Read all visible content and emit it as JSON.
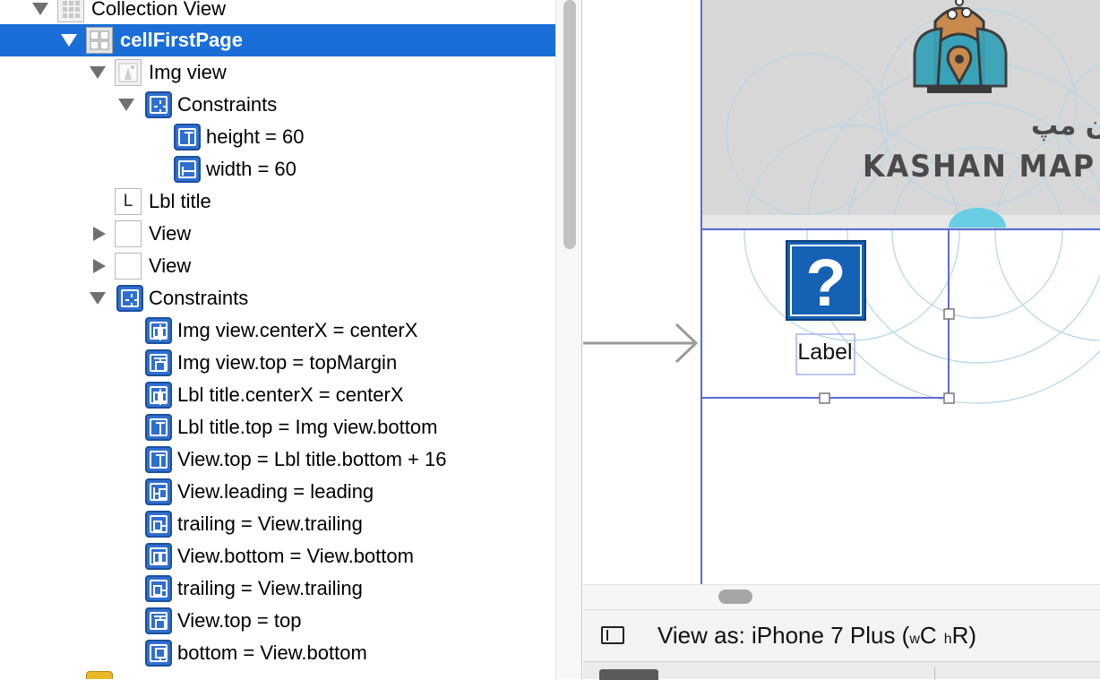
{
  "outline": {
    "rows": [
      {
        "label": "Collection View",
        "icon": "grid-icon"
      },
      {
        "label": "cellFirstPage",
        "icon": "cell-icon",
        "selected": true
      },
      {
        "label": "Img view",
        "icon": "image-view-icon"
      },
      {
        "label": "Constraints",
        "icon": "constraints-icon"
      },
      {
        "label": "height = 60",
        "icon": "height-constraint-icon"
      },
      {
        "label": "width = 60",
        "icon": "width-constraint-icon"
      },
      {
        "label": "Lbl title",
        "icon": "label-icon",
        "icon_text": "L"
      },
      {
        "label": "View",
        "icon": "view-icon"
      },
      {
        "label": "View",
        "icon": "view-icon"
      },
      {
        "label": "Constraints",
        "icon": "constraints-icon"
      },
      {
        "label": "Img view.centerX = centerX",
        "icon": "center-x-constraint-icon"
      },
      {
        "label": "Img view.top = topMargin",
        "icon": "top-constraint-icon"
      },
      {
        "label": "Lbl title.centerX = centerX",
        "icon": "center-x-constraint-icon"
      },
      {
        "label": "Lbl title.top = Img view.bottom",
        "icon": "vertical-spacing-constraint-icon"
      },
      {
        "label": "View.top = Lbl title.bottom + 16",
        "icon": "vertical-spacing-constraint-icon"
      },
      {
        "label": "View.leading = leading",
        "icon": "leading-constraint-icon"
      },
      {
        "label": "trailing = View.trailing",
        "icon": "trailing-constraint-icon"
      },
      {
        "label": "View.bottom = View.bottom",
        "icon": "bottom-constraint-icon"
      },
      {
        "label": "trailing = View.trailing",
        "icon": "trailing-constraint-icon"
      },
      {
        "label": "View.top = top",
        "icon": "top-constraint-icon"
      },
      {
        "label": "bottom = View.bottom",
        "icon": "bottom-constraint-icon"
      }
    ]
  },
  "canvas": {
    "logo_persian": "کاشان مپ",
    "logo_text": "KASHAN MAP",
    "cell_label": "Label",
    "question_icon": "question-mark-icon",
    "colors": {
      "selection": "#1a6ed8",
      "constraint_blue": "#2f6fd0",
      "canvas_guide": "#5b6bd6",
      "logo_brown": "#c98a4e",
      "logo_teal": "#38a3b8"
    }
  },
  "statusbar": {
    "view_as_prefix": "View as: iPhone 7 Plus (",
    "w_small": "w",
    "w_class": "C",
    "h_small": "h",
    "h_class": "R",
    "suffix": ")"
  }
}
